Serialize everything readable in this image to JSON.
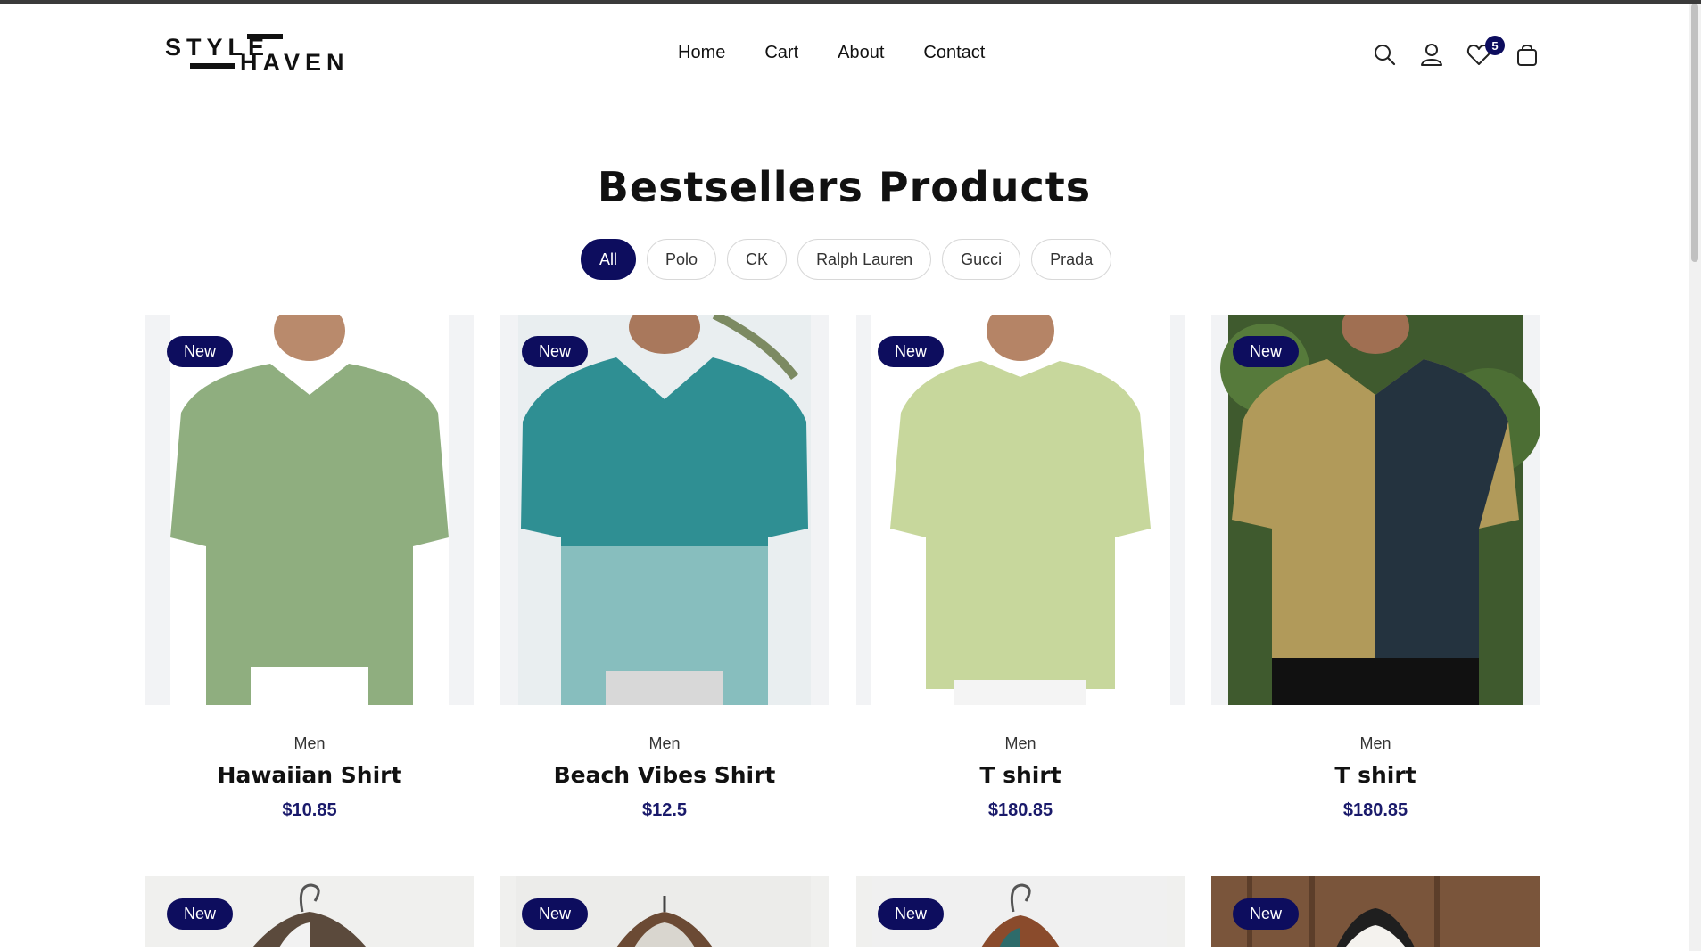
{
  "header": {
    "logo_top": "STYLE",
    "logo_bottom": "HAVEN",
    "nav": [
      "Home",
      "Cart",
      "About",
      "Contact"
    ],
    "wishlist_count": "5",
    "icons": [
      "search-icon",
      "user-icon",
      "heart-icon",
      "shopping-bag-icon"
    ]
  },
  "section": {
    "title": "Bestsellers Products",
    "filters": [
      "All",
      "Polo",
      "CK",
      "Ralph Lauren",
      "Gucci",
      "Prada"
    ],
    "active_filter": "All"
  },
  "products": [
    {
      "badge": "New",
      "category": "Men",
      "title": "Hawaiian Shirt",
      "price": "$10.85",
      "shirt_color": "#8fae7f"
    },
    {
      "badge": "New",
      "category": "Men",
      "title": "Beach Vibes Shirt",
      "price": "$12.5",
      "shirt_color": "#2f8f93"
    },
    {
      "badge": "New",
      "category": "Men",
      "title": "T shirt",
      "price": "$180.85",
      "shirt_color": "#c7d79c"
    },
    {
      "badge": "New",
      "category": "Men",
      "title": "T shirt",
      "price": "$180.85",
      "shirt_color": "#b19a5a"
    }
  ],
  "products_row2": [
    {
      "badge": "New"
    },
    {
      "badge": "New"
    },
    {
      "badge": "New"
    },
    {
      "badge": "New"
    }
  ],
  "colors": {
    "brand_navy": "#0d0d5e",
    "price_navy": "#1a1a6b"
  }
}
